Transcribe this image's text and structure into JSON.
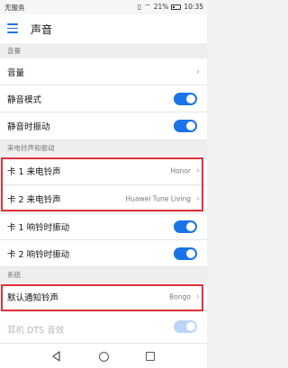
{
  "status_bar": {
    "carrier": "无服务",
    "battery": "21%",
    "time": "10:35",
    "icons": [
      "vibrate-icon",
      "wifi-icon",
      "battery-icon"
    ]
  },
  "app_bar": {
    "title": "声音",
    "menu_icon": "hamburger-menu-icon"
  },
  "sections": {
    "volume": "音量",
    "ringtone": "来电铃声和振动",
    "system": "系统"
  },
  "rows": {
    "volume": {
      "label": "音量"
    },
    "silent_mode": {
      "label": "静音模式",
      "on": true
    },
    "silent_vibrate": {
      "label": "静音时振动",
      "on": true
    },
    "sim1_ringtone": {
      "label": "卡 1 来电铃声",
      "value": "Honor"
    },
    "sim2_ringtone": {
      "label": "卡 2 来电铃声",
      "value": "Huawei Tune Living"
    },
    "sim1_vibrate": {
      "label": "卡 1 响铃时振动",
      "on": true
    },
    "sim2_vibrate": {
      "label": "卡 2 响铃时振动",
      "on": true
    },
    "notification_ringtone": {
      "label": "默认通知铃声",
      "value": "Bongo"
    },
    "dts": {
      "label": "耳机 DTS 音效",
      "on": true,
      "enabled": false
    }
  },
  "nav_bar": {
    "icons": [
      "back-icon",
      "home-icon",
      "recent-apps-icon"
    ]
  },
  "colors": {
    "accent": "#1a73e8",
    "highlight_border": "#e0313a"
  }
}
